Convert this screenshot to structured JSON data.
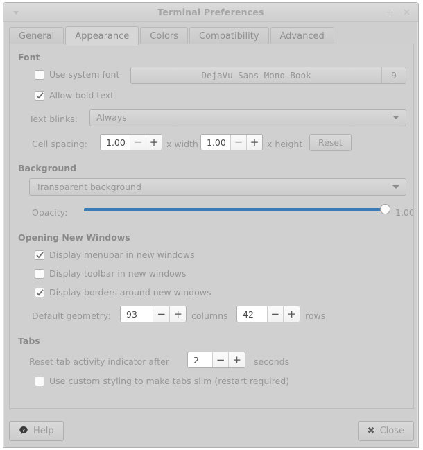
{
  "window": {
    "title": "Terminal Preferences",
    "menu_icon": "chevron-down-icon",
    "maximize_icon": "+",
    "close_icon": "×"
  },
  "tabs": [
    {
      "label": "General",
      "active": false
    },
    {
      "label": "Appearance",
      "active": true
    },
    {
      "label": "Colors",
      "active": false
    },
    {
      "label": "Compatibility",
      "active": false
    },
    {
      "label": "Advanced",
      "active": false
    }
  ],
  "font_section": {
    "title": "Font",
    "use_system_font": {
      "label": "Use system font",
      "checked": false
    },
    "font_button": {
      "name": "DejaVu Sans Mono Book",
      "size": "9"
    },
    "allow_bold": {
      "label": "Allow bold text",
      "checked": true
    },
    "text_blinks": {
      "label": "Text blinks:",
      "value": "Always"
    },
    "cell_spacing": {
      "label": "Cell spacing:",
      "width_value": "1.00",
      "width_suffix": "x width",
      "height_value": "1.00",
      "height_suffix": "x height",
      "reset_label": "Reset",
      "minus": "−",
      "plus": "+"
    }
  },
  "background_section": {
    "title": "Background",
    "mode": "Transparent background",
    "opacity_label": "Opacity:",
    "opacity_value": "1.00",
    "opacity_percent": 100,
    "slider_color": "#3b7cb8"
  },
  "windows_section": {
    "title": "Opening New Windows",
    "checkboxes": [
      {
        "label": "Display menubar in new windows",
        "checked": true
      },
      {
        "label": "Display toolbar in new windows",
        "checked": false
      },
      {
        "label": "Display borders around new windows",
        "checked": true
      }
    ],
    "geometry": {
      "label": "Default geometry:",
      "columns_value": "93",
      "columns_suffix": "columns",
      "rows_value": "42",
      "rows_suffix": "rows",
      "minus": "−",
      "plus": "+"
    }
  },
  "tabs_section": {
    "title": "Tabs",
    "reset_label": "Reset tab activity indicator after",
    "reset_value": "2",
    "reset_suffix": "seconds",
    "minus": "−",
    "plus": "+",
    "slim_tabs": {
      "label": "Use custom styling to make tabs slim (restart required)",
      "checked": false
    }
  },
  "footer": {
    "help_label": "Help",
    "help_icon": "question-mark-icon",
    "close_label": "Close",
    "close_icon": "✖"
  }
}
